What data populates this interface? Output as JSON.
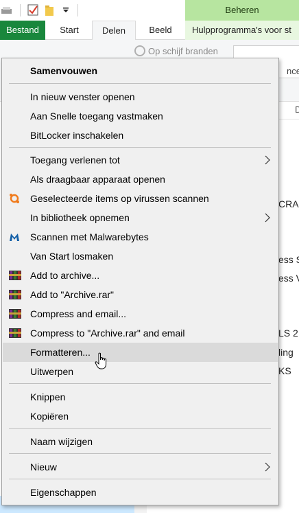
{
  "quick_access": {
    "icons": [
      "properties-icon",
      "checkmark-icon",
      "folder-icon",
      "dropdown-arrow-icon"
    ]
  },
  "ribbon": {
    "context_group_label": "Beheren",
    "tabs": [
      {
        "label": "Bestand"
      },
      {
        "label": "Start"
      },
      {
        "label": "Delen"
      },
      {
        "label": "Beeld"
      },
      {
        "label": "Hulpprogramma's voor st"
      }
    ],
    "burn_button_label": "Op schijf branden",
    "address_fragment": "ncee",
    "column_fragment": "D"
  },
  "background_files": [
    {
      "text": "CRAF"
    },
    {
      "text": "ess S"
    },
    {
      "text": "ess V"
    },
    {
      "text": "LS 2"
    },
    {
      "text": "ling"
    },
    {
      "text": "KS"
    }
  ],
  "context_menu": {
    "items": [
      {
        "label": "Samenvouwen",
        "bold": true
      },
      {
        "label": "In nieuw venster openen"
      },
      {
        "label": "Aan Snelle toegang vastmaken"
      },
      {
        "label": "BitLocker inschakelen"
      },
      {
        "label": "Toegang verlenen tot",
        "submenu": true
      },
      {
        "label": "Als draagbaar apparaat openen"
      },
      {
        "label": "Geselecteerde items op virussen scannen",
        "icon": "avast-icon"
      },
      {
        "label": "In bibliotheek opnemen",
        "submenu": true
      },
      {
        "label": "Scannen met Malwarebytes",
        "icon": "malwarebytes-icon"
      },
      {
        "label": "Van Start losmaken"
      },
      {
        "label": "Add to archive...",
        "icon": "winrar-icon"
      },
      {
        "label": "Add to \"Archive.rar\"",
        "icon": "winrar-icon"
      },
      {
        "label": "Compress and email...",
        "icon": "winrar-icon"
      },
      {
        "label": "Compress to \"Archive.rar\" and email",
        "icon": "winrar-icon"
      },
      {
        "label": "Formatteren...",
        "hovered": true
      },
      {
        "label": "Uitwerpen"
      },
      {
        "label": "Knippen"
      },
      {
        "label": "Kopiëren"
      },
      {
        "label": "Naam wijzigen"
      },
      {
        "label": "Nieuw",
        "submenu": true
      },
      {
        "label": "Eigenschappen"
      }
    ]
  },
  "colors": {
    "file_tab": "#19873c",
    "context_group_band": "#b7e5a0",
    "menu_background": "#f0f0f0",
    "hover": "#dadada",
    "avast": "#f07b1c",
    "malwarebytes": "#1460a8"
  }
}
